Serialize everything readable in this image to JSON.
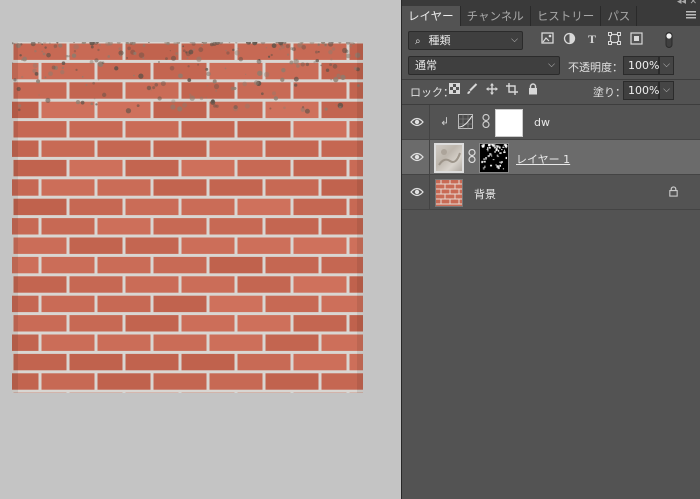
{
  "panel": {
    "tabs": [
      "レイヤー",
      "チャンネル",
      "ヒストリー",
      "パス"
    ],
    "filter": {
      "value": "種類"
    },
    "blend_mode": "通常",
    "opacity_label": "不透明度：",
    "opacity_value": "100%",
    "lock_label": "ロック：",
    "fill_label": "塗り：",
    "fill_value": "100%"
  },
  "layers": [
    {
      "name": "dw",
      "type": "clipped-adjustment-with-mask",
      "visible": true,
      "selected": false
    },
    {
      "name": "レイヤー 1",
      "type": "pixel-with-mask",
      "visible": true,
      "selected": true
    },
    {
      "name": "背景",
      "type": "background",
      "visible": true,
      "selected": false,
      "locked": true
    }
  ],
  "colors": {
    "brick": "#c86a55",
    "mortar": "#d9d6d2",
    "panel_bg": "#535353",
    "selected_row": "#6b6b6b"
  }
}
